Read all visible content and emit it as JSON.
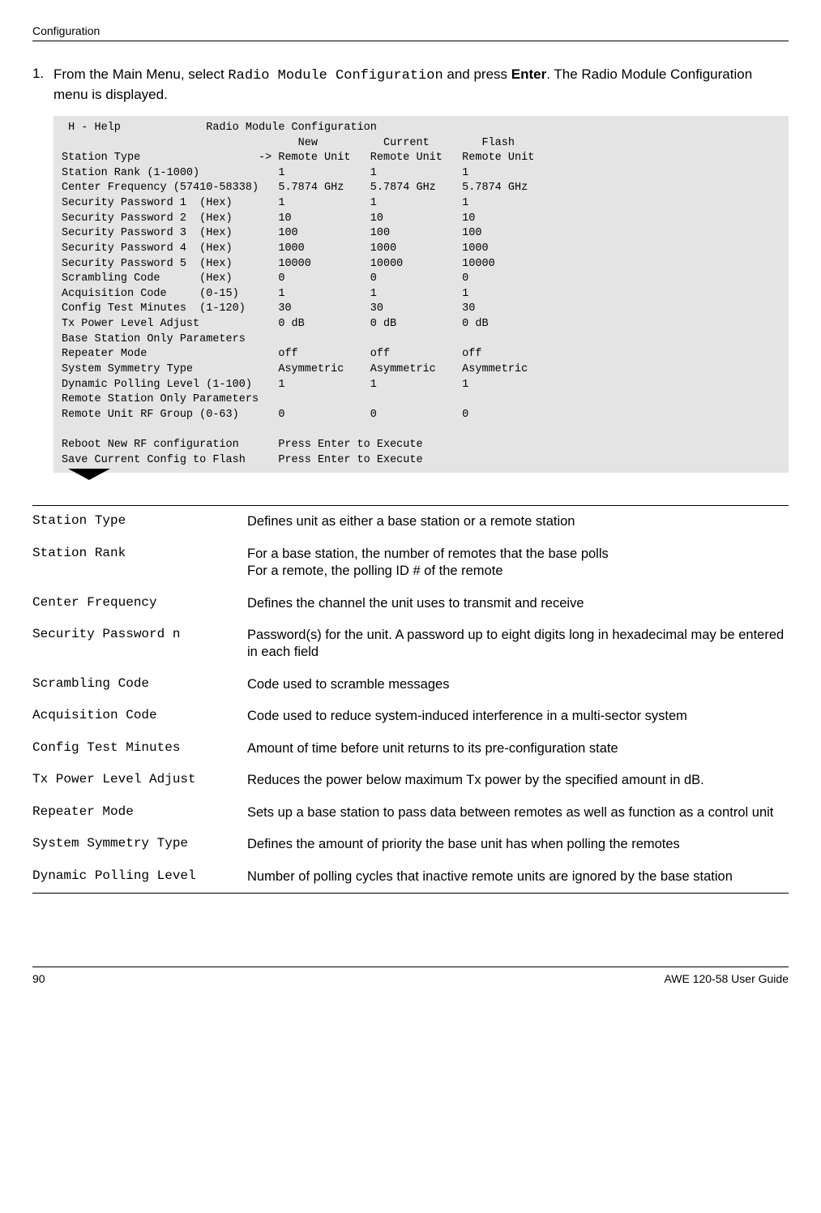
{
  "header": "Configuration",
  "step": {
    "number": "1.",
    "prefix": "From the Main Menu, select ",
    "mono": "Radio Module Configuration",
    "mid": " and press ",
    "bold": "Enter",
    "suffix": ". The Radio Module Configuration menu is displayed."
  },
  "terminal": " H - Help             Radio Module Configuration\n                                    New          Current        Flash\nStation Type                  -> Remote Unit   Remote Unit   Remote Unit\nStation Rank (1-1000)            1             1             1\nCenter Frequency (57410-58338)   5.7874 GHz    5.7874 GHz    5.7874 GHz\nSecurity Password 1  (Hex)       1             1             1\nSecurity Password 2  (Hex)       10            10            10\nSecurity Password 3  (Hex)       100           100           100\nSecurity Password 4  (Hex)       1000          1000          1000\nSecurity Password 5  (Hex)       10000         10000         10000\nScrambling Code      (Hex)       0             0             0\nAcquisition Code     (0-15)      1             1             1\nConfig Test Minutes  (1-120)     30            30            30\nTx Power Level Adjust            0 dB          0 dB          0 dB\nBase Station Only Parameters\nRepeater Mode                    off           off           off\nSystem Symmetry Type             Asymmetric    Asymmetric    Asymmetric\nDynamic Polling Level (1-100)    1             1             1\nRemote Station Only Parameters\nRemote Unit RF Group (0-63)      0             0             0\n\nReboot New RF configuration      Press Enter to Execute\nSave Current Config to Flash     Press Enter to Execute",
  "defs": [
    {
      "term": "Station Type",
      "desc": "Defines unit as either a base station or a remote station"
    },
    {
      "term": "Station Rank",
      "desc": "For a base station, the number of remotes that the base polls\nFor a remote, the polling ID # of the remote"
    },
    {
      "term": "Center Frequency",
      "desc": "Defines the channel the unit uses to transmit and receive"
    },
    {
      "term": "Security Password n",
      "desc": "Password(s) for the unit. A password up to eight digits long in hexadecimal may be entered in each field"
    },
    {
      "term": "Scrambling Code",
      "desc": "Code used to scramble messages"
    },
    {
      "term": "Acquisition Code",
      "desc": "Code used to reduce system-induced interference in a multi-sector system"
    },
    {
      "term": "Config Test Minutes",
      "desc": "Amount of time before unit returns to its pre-configuration state"
    },
    {
      "term": "Tx Power Level Adjust",
      "desc": "Reduces the power below maximum Tx power by the specified amount in dB."
    },
    {
      "term": "Repeater Mode",
      "desc": "Sets up a base station to pass data between remotes as well as function as a control unit"
    },
    {
      "term": "System Symmetry Type",
      "desc": "Defines the amount of priority the base unit has when polling the remotes"
    },
    {
      "term": "Dynamic Polling Level",
      "desc": "Number of polling cycles that inactive remote units are ignored by the base station"
    }
  ],
  "footer": {
    "page": "90",
    "title": "AWE 120-58 User Guide"
  }
}
